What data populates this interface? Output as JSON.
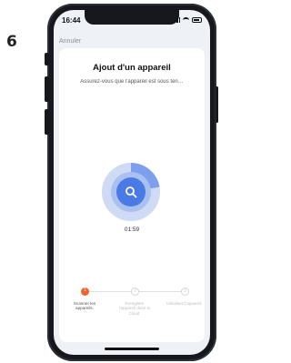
{
  "step_number": "6",
  "status_bar": {
    "time": "16:44"
  },
  "nav": {
    "cancel_label": "Annuler"
  },
  "card": {
    "title": "Ajout d'un appareil",
    "subtitle": "Assurez-vous que l'appareil est sous ten…"
  },
  "scan": {
    "icon": "search-icon",
    "timer": "01:59"
  },
  "steps": [
    {
      "number": "1",
      "label": "Scanner les appareils.",
      "active": true
    },
    {
      "number": "2",
      "label": "Enregistre l'appareil dans le Cloud.",
      "active": false
    },
    {
      "number": "3",
      "label": "Initialisez l'appareil.",
      "active": false
    }
  ],
  "colors": {
    "accent": "#4a7ae6",
    "step_active": "#f0622f"
  }
}
